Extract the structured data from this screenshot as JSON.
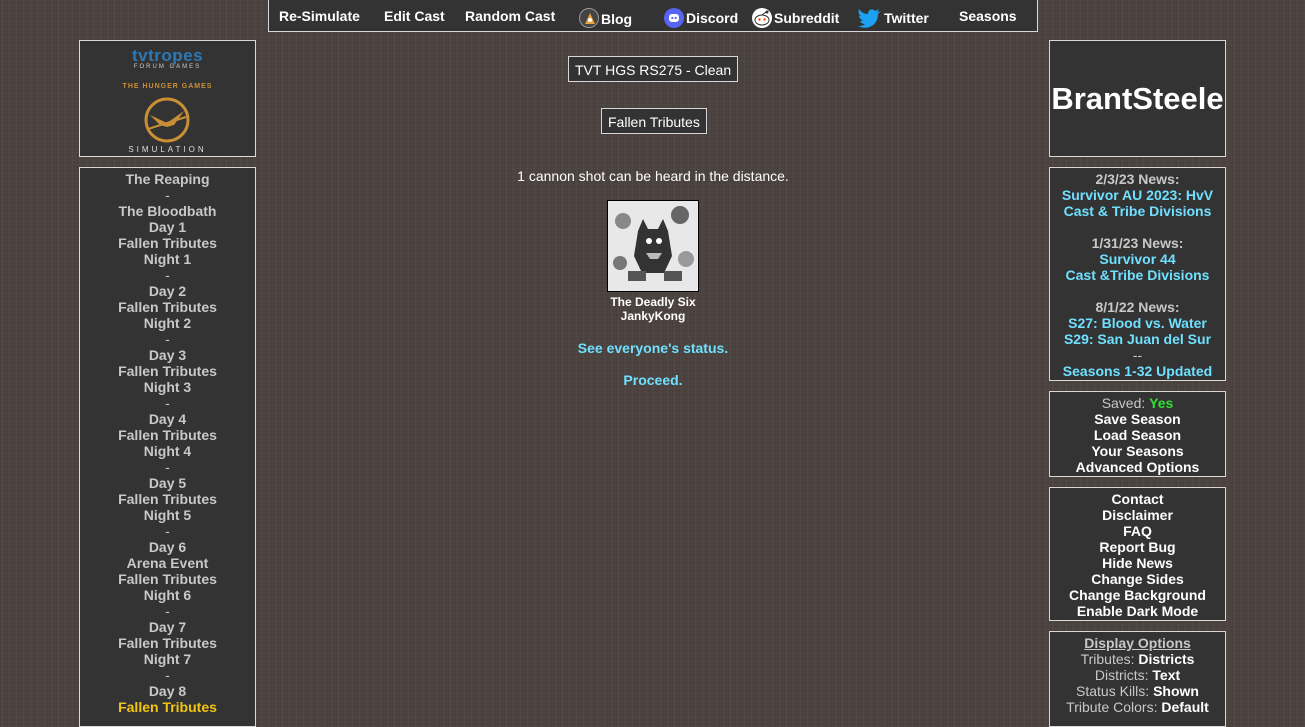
{
  "topnav": {
    "resimulate": "Re-Simulate",
    "edit_cast": "Edit Cast",
    "random_cast": "Random Cast",
    "blog": "Blog",
    "discord": "Discord",
    "subreddit": "Subreddit",
    "twitter": "Twitter",
    "seasons": "Seasons"
  },
  "logo": {
    "line1": "tvtropes",
    "line2": "FORUM GAMES",
    "line3": "THE HUNGER GAMES",
    "line4": "SIMULATION"
  },
  "leftnav": [
    {
      "label": "The Reaping",
      "state": "normal"
    },
    {
      "label": "-",
      "state": "sep"
    },
    {
      "label": "The Bloodbath",
      "state": "normal"
    },
    {
      "label": "Day 1",
      "state": "normal"
    },
    {
      "label": "Fallen Tributes",
      "state": "normal"
    },
    {
      "label": "Night 1",
      "state": "normal"
    },
    {
      "label": "-",
      "state": "sep"
    },
    {
      "label": "Day 2",
      "state": "normal"
    },
    {
      "label": "Fallen Tributes",
      "state": "normal"
    },
    {
      "label": "Night 2",
      "state": "normal"
    },
    {
      "label": "-",
      "state": "sep"
    },
    {
      "label": "Day 3",
      "state": "normal"
    },
    {
      "label": "Fallen Tributes",
      "state": "normal"
    },
    {
      "label": "Night 3",
      "state": "normal"
    },
    {
      "label": "-",
      "state": "sep"
    },
    {
      "label": "Day 4",
      "state": "normal"
    },
    {
      "label": "Fallen Tributes",
      "state": "normal"
    },
    {
      "label": "Night 4",
      "state": "normal"
    },
    {
      "label": "-",
      "state": "sep"
    },
    {
      "label": "Day 5",
      "state": "normal"
    },
    {
      "label": "Fallen Tributes",
      "state": "normal"
    },
    {
      "label": "Night 5",
      "state": "normal"
    },
    {
      "label": "-",
      "state": "sep"
    },
    {
      "label": "Day 6",
      "state": "normal"
    },
    {
      "label": "Arena Event",
      "state": "normal"
    },
    {
      "label": "Fallen Tributes",
      "state": "normal"
    },
    {
      "label": "Night 6",
      "state": "normal"
    },
    {
      "label": "-",
      "state": "sep"
    },
    {
      "label": "Day 7",
      "state": "normal"
    },
    {
      "label": "Fallen Tributes",
      "state": "normal"
    },
    {
      "label": "Night 7",
      "state": "normal"
    },
    {
      "label": "-",
      "state": "sep"
    },
    {
      "label": "Day 8",
      "state": "normal"
    },
    {
      "label": "Fallen Tributes",
      "state": "current"
    }
  ],
  "main": {
    "season_title": "TVT HGS RS275 - Clean",
    "section_title": "Fallen Tributes",
    "cannon_text": "1 cannon shot can be heard in the distance.",
    "tribute_name": "The Deadly Six",
    "tribute_district": "JankyKong",
    "status_link": "See everyone's status.",
    "proceed_link": "Proceed."
  },
  "brand": "BrantSteele",
  "news": [
    {
      "date": "2/3/23 News:",
      "links": [
        "Survivor AU 2023: HvV",
        "Cast & Tribe Divisions"
      ]
    },
    {
      "date": "1/31/23 News:",
      "links": [
        "Survivor 44",
        "Cast &Tribe Divisions"
      ]
    },
    {
      "date": "8/1/22 News:",
      "links": [
        "S27: Blood vs. Water",
        "S29: San Juan del Sur"
      ],
      "sep": "--",
      "extra": "Seasons 1-32 Updated"
    }
  ],
  "saved": {
    "label": "Saved:",
    "value": "Yes",
    "links": [
      "Save Season",
      "Load Season",
      "Your Seasons",
      "Advanced Options"
    ]
  },
  "misc_links": [
    "Contact",
    "Disclaimer",
    "FAQ",
    "Report Bug",
    "Hide News",
    "Change Sides",
    "Change Background",
    "Enable Dark Mode"
  ],
  "display_options": {
    "header": "Display Options",
    "items": [
      {
        "label": "Tributes:",
        "value": "Districts"
      },
      {
        "label": "Districts:",
        "value": "Text"
      },
      {
        "label": "Status Kills:",
        "value": "Shown"
      },
      {
        "label": "Tribute Colors:",
        "value": "Default"
      }
    ]
  },
  "colors": {
    "link_cyan": "#6fe0ff",
    "current_yellow": "#f2c513",
    "saved_green": "#2fe02f",
    "panel_bg": "#333333"
  }
}
